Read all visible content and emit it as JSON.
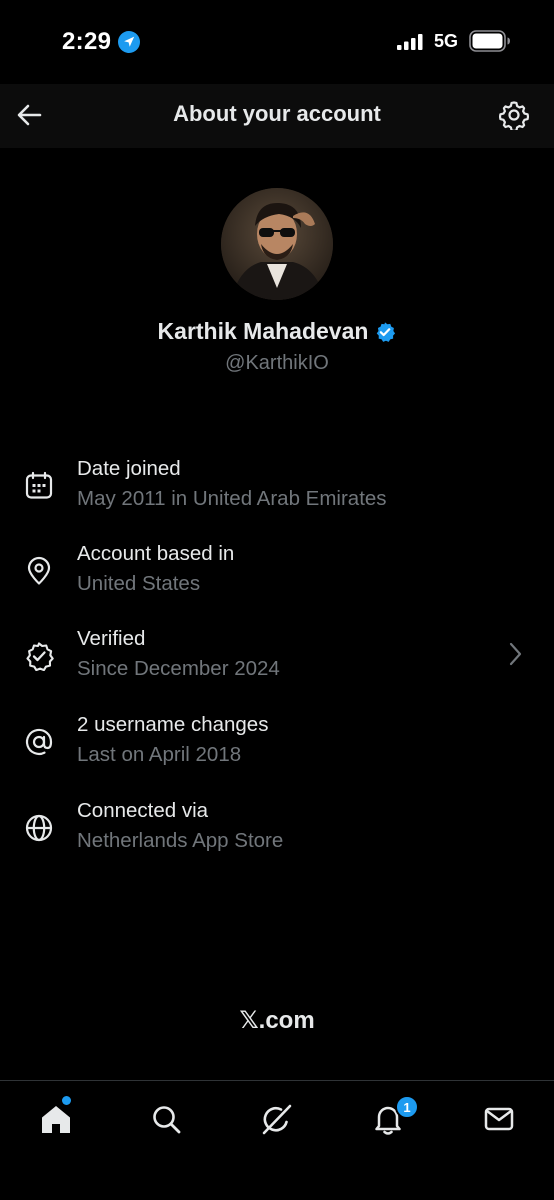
{
  "status_bar": {
    "time": "2:29",
    "network": "5G"
  },
  "header": {
    "title": "About your account"
  },
  "profile": {
    "display_name": "Karthik Mahadevan",
    "handle": "@KarthikIO",
    "verified": true
  },
  "info_items": [
    {
      "icon": "calendar-icon",
      "title": "Date joined",
      "subtitle": "May 2011 in United Arab Emirates"
    },
    {
      "icon": "location-pin-icon",
      "title": "Account based in",
      "subtitle": "United States"
    },
    {
      "icon": "verified-badge-icon",
      "title": "Verified",
      "subtitle": "Since December 2024",
      "has_chevron": true
    },
    {
      "icon": "at-sign-icon",
      "title": "2 username changes",
      "subtitle": "Last on April 2018"
    },
    {
      "icon": "globe-icon",
      "title": "Connected via",
      "subtitle": "Netherlands App Store"
    }
  ],
  "footer": {
    "site": "𝕏.com"
  },
  "bottom_nav": {
    "items": [
      "home",
      "search",
      "grok",
      "notifications",
      "messages"
    ],
    "notification_count": "1"
  },
  "colors": {
    "background": "#000000",
    "header_bg": "#0c0c0c",
    "primary_text": "#e7e9ea",
    "secondary_text": "#71767b",
    "accent": "#1d9bf0"
  }
}
